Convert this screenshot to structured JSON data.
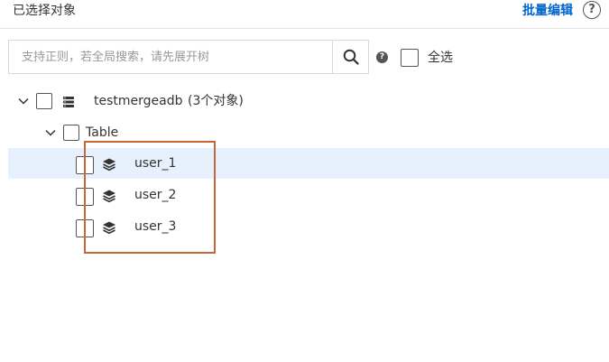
{
  "header": {
    "title": "已选择对象",
    "batch_edit_label": "批量编辑",
    "help_icon_glyph": "?"
  },
  "search": {
    "placeholder": "支持正则，若全局搜索，请先展开树",
    "value": "",
    "icon": "search-icon"
  },
  "info_icon_glyph": "?",
  "select_all": {
    "label": "全选",
    "checked": false
  },
  "tree": {
    "database": {
      "name": "testmergeadb",
      "count_label": "(3个对象)",
      "icon": "database-icon",
      "expanded": true,
      "checked": false
    },
    "group": {
      "label": "Table",
      "expanded": true,
      "checked": false
    },
    "tables": [
      {
        "name": "user_1",
        "icon": "layers-icon",
        "checked": false,
        "highlighted": true
      },
      {
        "name": "user_2",
        "icon": "layers-icon",
        "checked": false,
        "highlighted": false
      },
      {
        "name": "user_3",
        "icon": "layers-icon",
        "checked": false,
        "highlighted": false
      }
    ]
  },
  "colors": {
    "accent": "#0066cc",
    "highlight_row": "#e7f0fd",
    "annotation_border": "#c4683a"
  }
}
